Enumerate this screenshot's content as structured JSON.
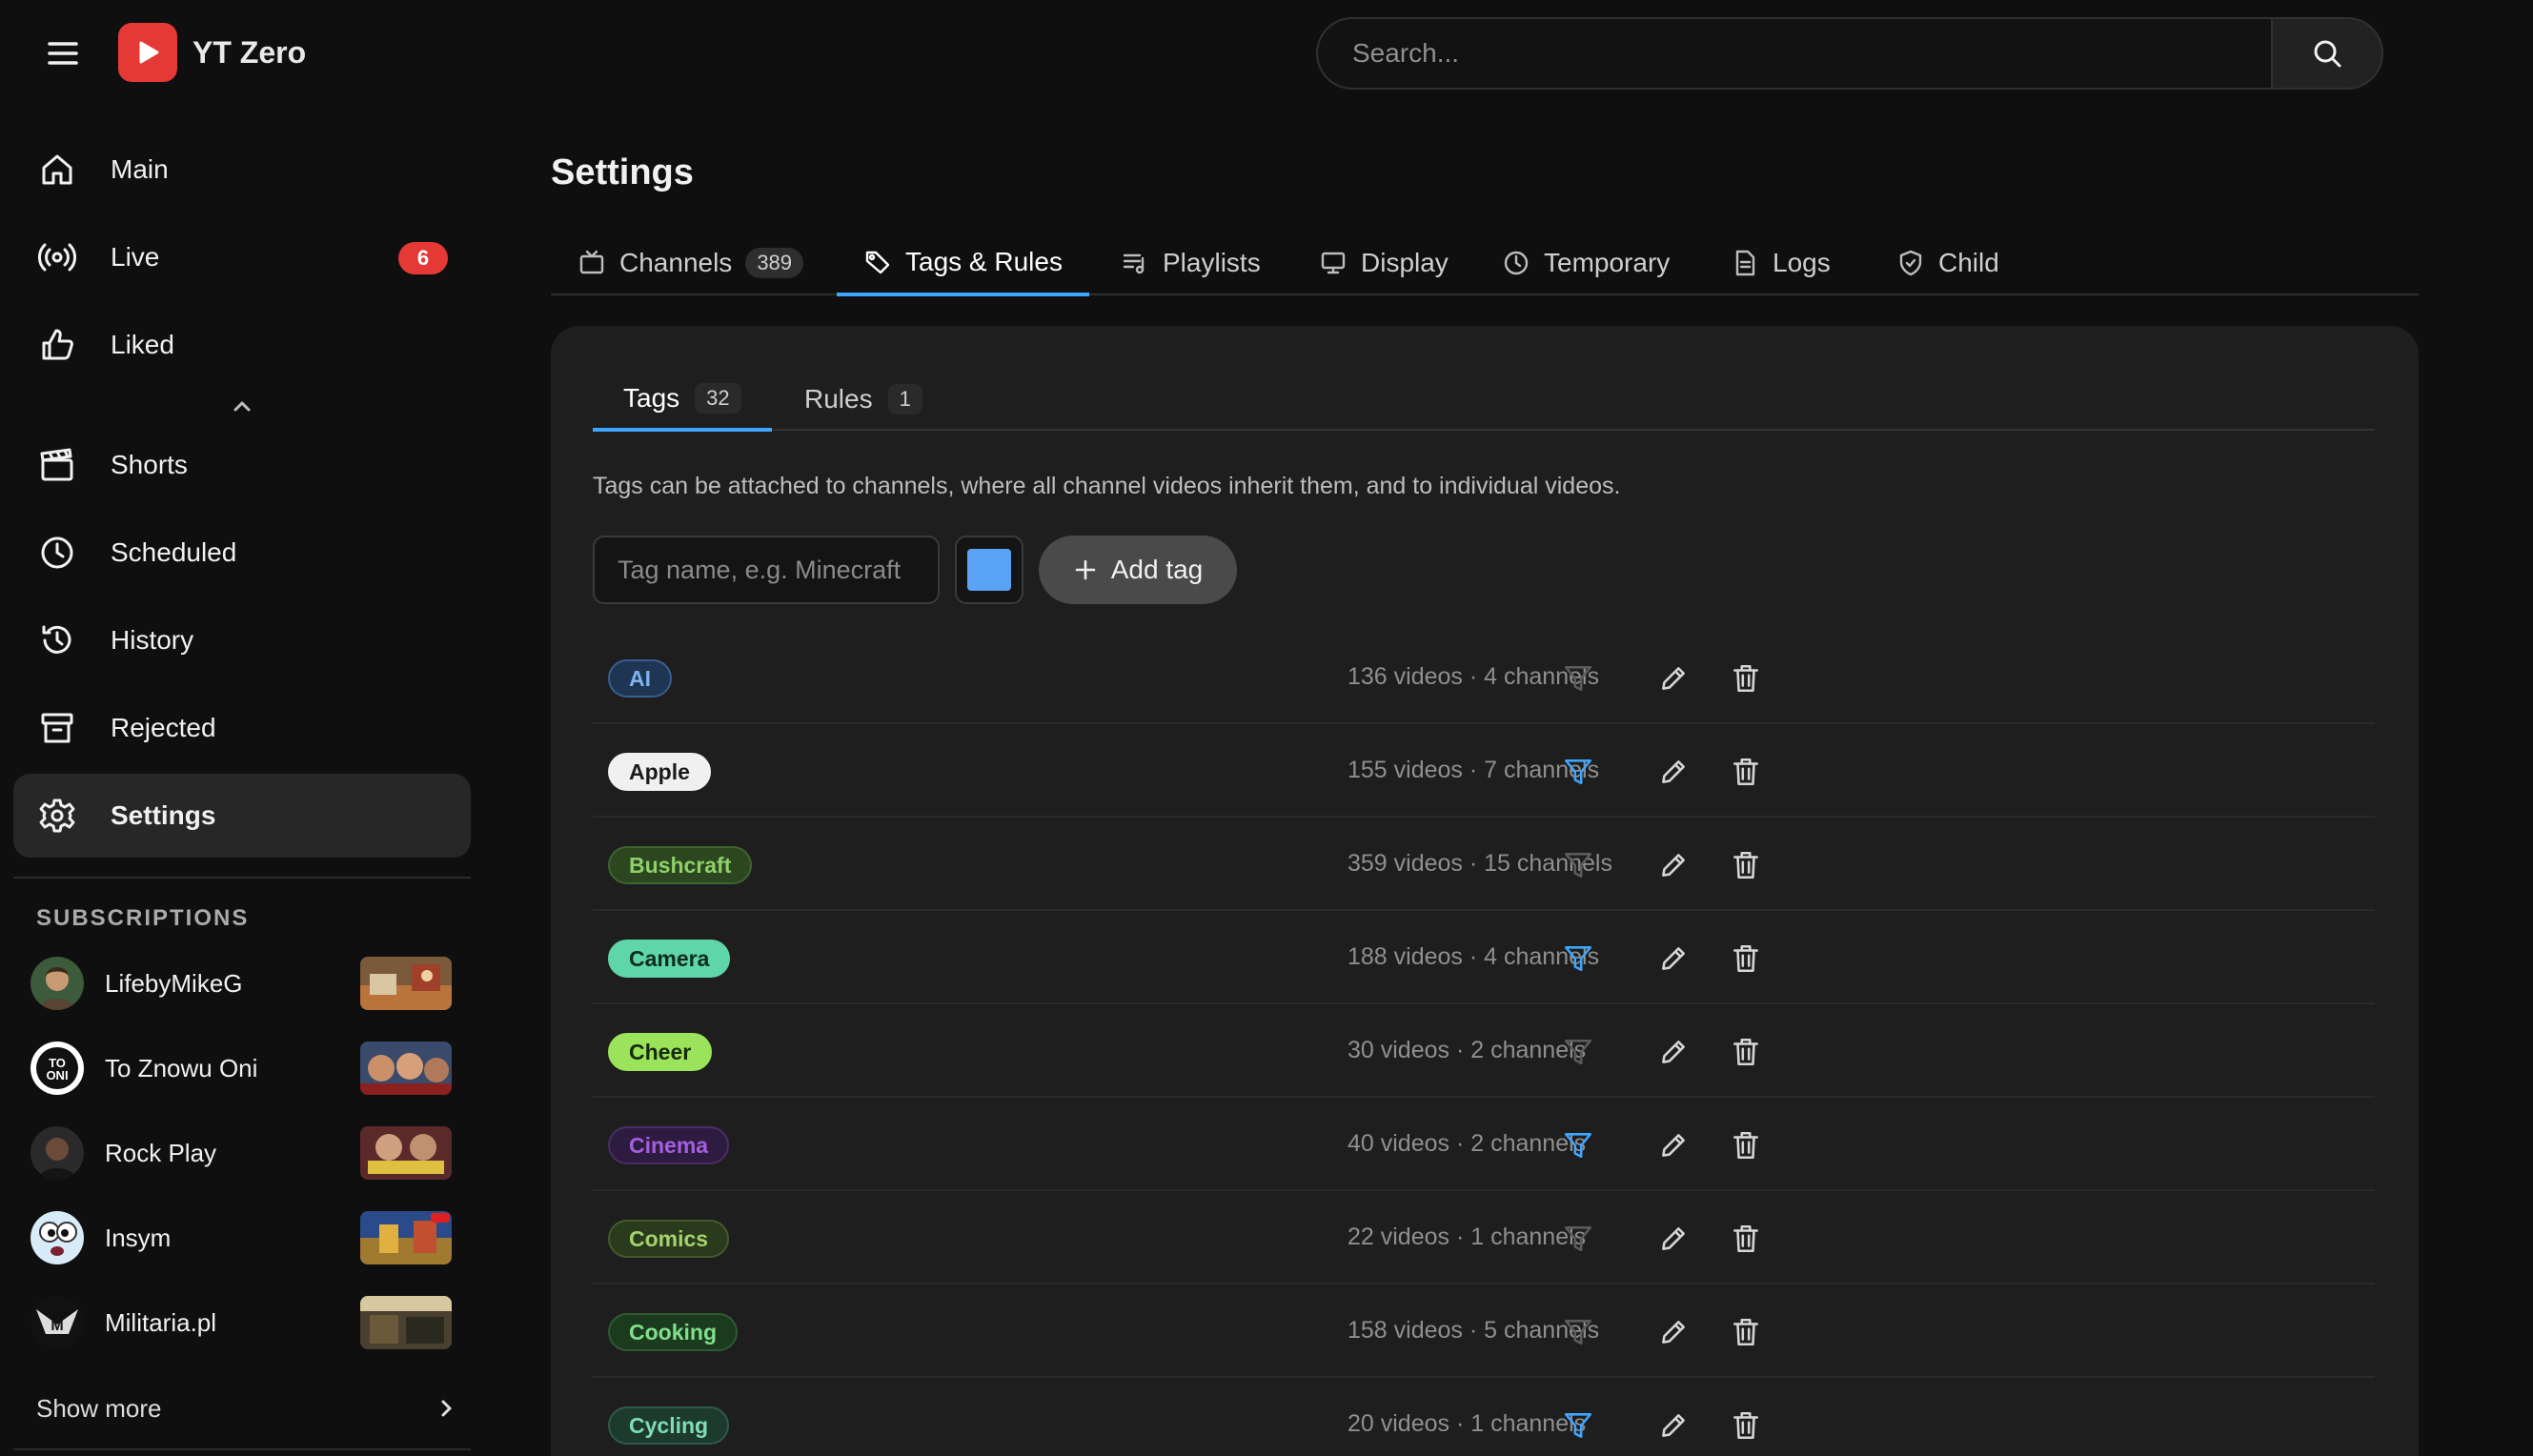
{
  "app": {
    "title": "YT Zero"
  },
  "search": {
    "placeholder": "Search..."
  },
  "sidebar": {
    "items": [
      {
        "label": "Main",
        "icon": "home-icon"
      },
      {
        "label": "Live",
        "icon": "live-icon",
        "badge": "6"
      },
      {
        "label": "Liked",
        "icon": "thumbs-up-icon"
      },
      {
        "label": "Shorts",
        "icon": "clapperboard-icon"
      },
      {
        "label": "Scheduled",
        "icon": "clock-icon"
      },
      {
        "label": "History",
        "icon": "history-icon"
      },
      {
        "label": "Rejected",
        "icon": "archive-icon"
      },
      {
        "label": "Settings",
        "icon": "gear-icon",
        "active": true
      }
    ],
    "subscriptions_heading": "SUBSCRIPTIONS",
    "subscriptions": [
      {
        "name": "LifebyMikeG"
      },
      {
        "name": "To Znowu Oni"
      },
      {
        "name": "Rock Play"
      },
      {
        "name": "Insym"
      },
      {
        "name": "Militaria.pl"
      }
    ],
    "show_more": "Show more"
  },
  "page": {
    "title": "Settings"
  },
  "tabs": [
    {
      "label": "Channels",
      "icon": "tv-icon",
      "count": "389"
    },
    {
      "label": "Tags & Rules",
      "icon": "tag-icon",
      "active": true
    },
    {
      "label": "Playlists",
      "icon": "playlist-icon"
    },
    {
      "label": "Display",
      "icon": "monitor-icon"
    },
    {
      "label": "Temporary",
      "icon": "clock-icon"
    },
    {
      "label": "Logs",
      "icon": "document-icon"
    },
    {
      "label": "Child",
      "icon": "shield-icon"
    }
  ],
  "subtabs": [
    {
      "label": "Tags",
      "count": "32",
      "active": true
    },
    {
      "label": "Rules",
      "count": "1"
    }
  ],
  "description": "Tags can be attached to channels, where all channel videos inherit them, and to individual videos.",
  "tag_form": {
    "placeholder": "Tag name, e.g. Minecraft",
    "color": "#5aa2f5",
    "add_label": "Add tag"
  },
  "colors": {
    "accent": "#3ea6ff",
    "filter_active": "#3ea6ff",
    "filter_inactive": "#5c5c5c",
    "live_badge": "#e53935"
  },
  "tags": [
    {
      "name": "AI",
      "stats": "136 videos · 4 channels",
      "filter_active": false,
      "bg": "#1e3553",
      "fg": "#7fb2ee",
      "border": "#3a5f8f"
    },
    {
      "name": "Apple",
      "stats": "155 videos · 7 channels",
      "filter_active": true,
      "bg": "#f0f0f0",
      "fg": "#1a1a1a",
      "border": "#f0f0f0"
    },
    {
      "name": "Bushcraft",
      "stats": "359 videos · 15 channels",
      "filter_active": false,
      "bg": "#2c4620",
      "fg": "#8ed06a",
      "border": "#3f6430"
    },
    {
      "name": "Camera",
      "stats": "188 videos · 4 channels",
      "filter_active": true,
      "bg": "#5fd6a9",
      "fg": "#0d2b20",
      "border": "#5fd6a9"
    },
    {
      "name": "Cheer",
      "stats": "30 videos · 2 channels",
      "filter_active": false,
      "bg": "#9be35a",
      "fg": "#16290a",
      "border": "#9be35a"
    },
    {
      "name": "Cinema",
      "stats": "40 videos · 2 channels",
      "filter_active": true,
      "bg": "#2e1c40",
      "fg": "#a55ee0",
      "border": "#4a2d66"
    },
    {
      "name": "Comics",
      "stats": "22 videos · 1 channels",
      "filter_active": false,
      "bg": "#2a3a1c",
      "fg": "#a4d36b",
      "border": "#44592d"
    },
    {
      "name": "Cooking",
      "stats": "158 videos · 5 channels",
      "filter_active": false,
      "bg": "#1c3a1e",
      "fg": "#7fe08a",
      "border": "#2f5a33"
    },
    {
      "name": "Cycling",
      "stats": "20 videos · 1 channels",
      "filter_active": true,
      "bg": "#1c3a2e",
      "fg": "#7fdcb3",
      "border": "#2e5a48"
    }
  ]
}
